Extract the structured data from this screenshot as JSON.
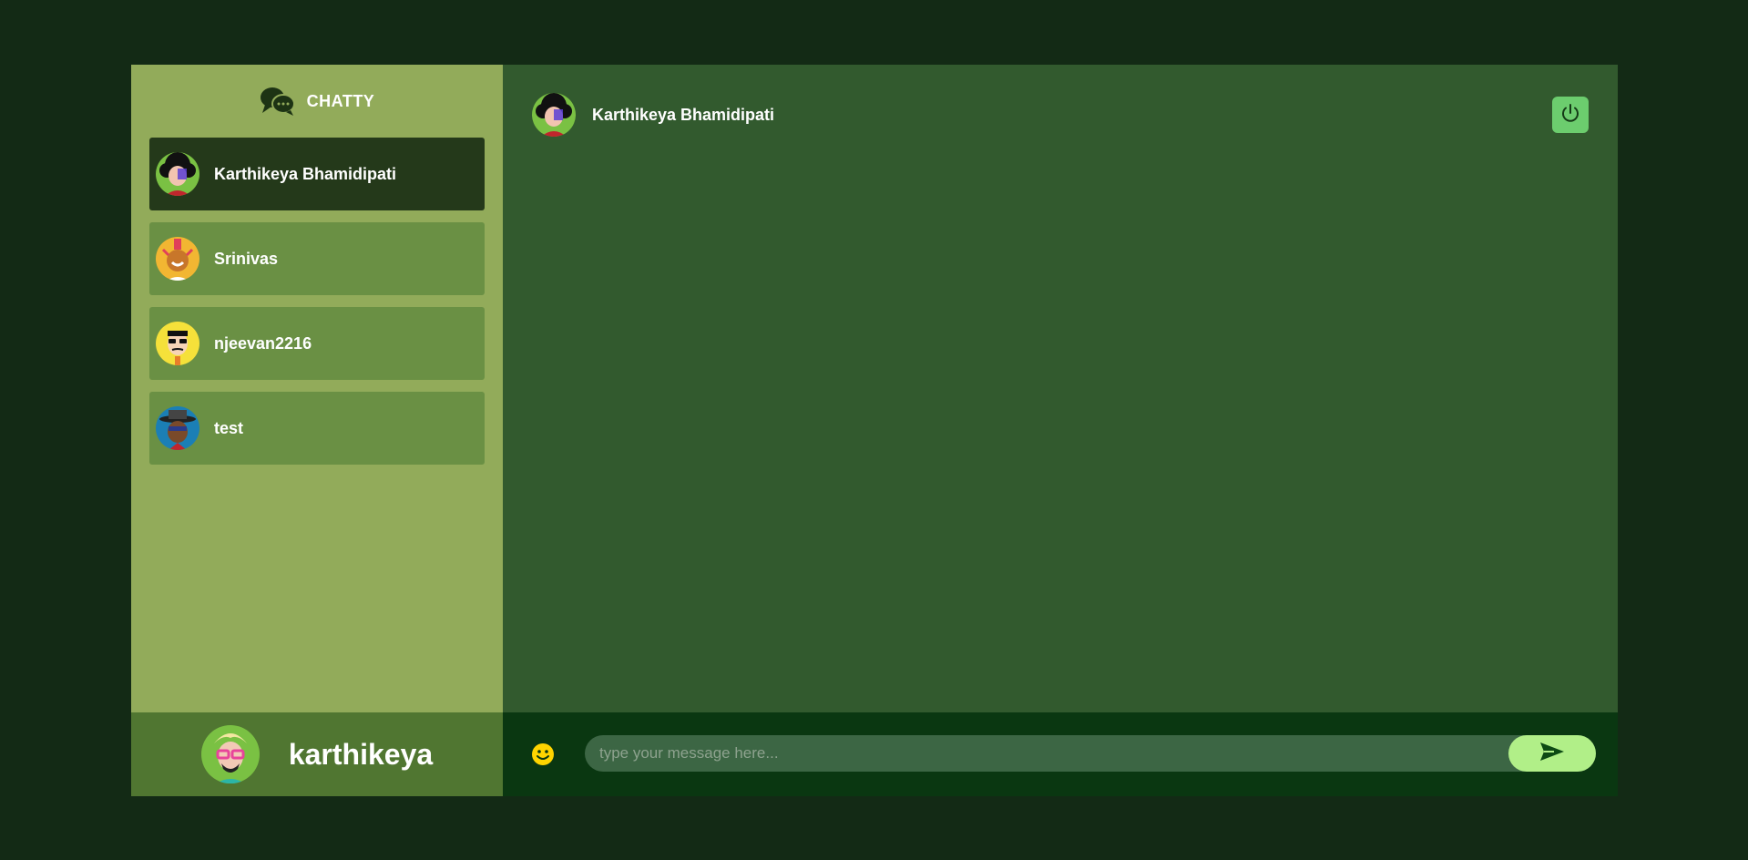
{
  "app": {
    "brand": "CHATTY"
  },
  "sidebar": {
    "contacts": [
      {
        "name": "Karthikeya Bhamidipati",
        "avatar": "avatar-afro-purple",
        "selected": true
      },
      {
        "name": "Srinivas",
        "avatar": "avatar-mohawk-orange",
        "selected": false
      },
      {
        "name": "njeevan2216",
        "avatar": "avatar-glasses-yellow",
        "selected": false
      },
      {
        "name": "test",
        "avatar": "avatar-hat-blue",
        "selected": false
      }
    ],
    "current_user": {
      "name": "karthikeya",
      "avatar": "avatar-blonde-glasses"
    }
  },
  "chat": {
    "header_name": "Karthikeya Bhamidipati",
    "logout_icon": "power-icon",
    "input_placeholder": "type your message here...",
    "emoji_icon": "smiley-icon",
    "send_icon": "send-icon"
  },
  "colors": {
    "page_bg": "#132a15",
    "sidebar_bg": "#92ab5a",
    "contact_bg": "#6a9044",
    "contact_selected_bg": "#24391a",
    "current_user_bg": "#507631",
    "chat_bg": "#325a2e",
    "input_bar_bg": "#0a3711",
    "input_bg": "#3c6644",
    "send_bg": "#b1ef88",
    "logout_bg": "#6ccd6e",
    "emoji": "#ffd400"
  }
}
